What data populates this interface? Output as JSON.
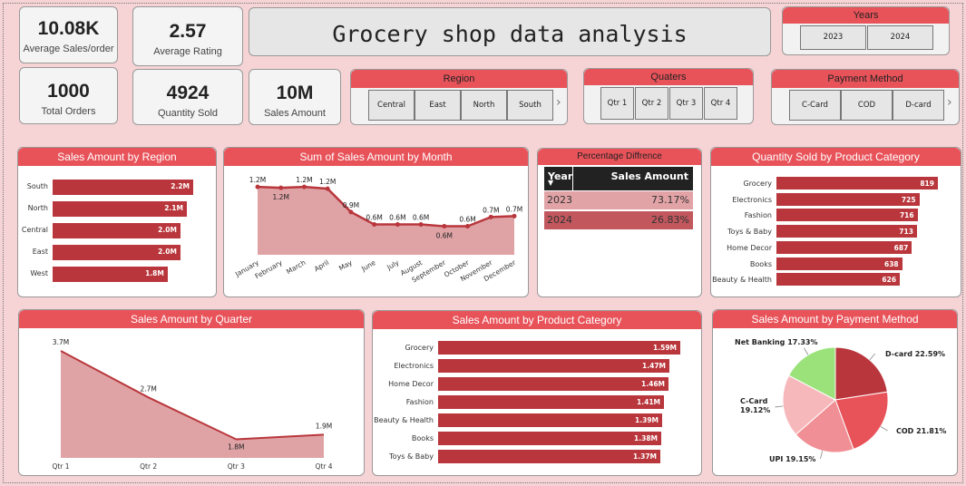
{
  "title": "Grocery shop data analysis",
  "kpis": [
    {
      "value": "10.08K",
      "label": "Average Sales/order"
    },
    {
      "value": "2.57",
      "label": "Average Rating"
    },
    {
      "value": "1000",
      "label": "Total Orders"
    },
    {
      "value": "4924",
      "label": "Quantity Sold"
    },
    {
      "value": "10M",
      "label": "Sales Amount"
    }
  ],
  "slicers": {
    "years": {
      "title": "Years",
      "options": [
        "2023",
        "2024"
      ]
    },
    "region": {
      "title": "Region",
      "options": [
        "Central",
        "East",
        "North",
        "South"
      ]
    },
    "quarters": {
      "title": "Quaters",
      "options": [
        "Qtr 1",
        "Qtr 2",
        "Qtr 3",
        "Qtr 4"
      ]
    },
    "payment": {
      "title": "Payment Method",
      "options": [
        "C-Card",
        "COD",
        "D-card"
      ]
    }
  },
  "region_chart": {
    "title": "Sales Amount by Region",
    "categories": [
      "South",
      "North",
      "Central",
      "East",
      "West"
    ],
    "values": [
      2.2,
      2.1,
      2.0,
      2.0,
      1.8
    ],
    "labels": [
      "2.2M",
      "2.1M",
      "2.0M",
      "2.0M",
      "1.8M"
    ]
  },
  "month_chart": {
    "title": "Sum of Sales Amount by Month",
    "months": [
      "January",
      "February",
      "March",
      "April",
      "May",
      "June",
      "July",
      "August",
      "September",
      "October",
      "November",
      "December"
    ],
    "values": [
      1.2,
      1.2,
      1.2,
      1.2,
      0.9,
      0.6,
      0.6,
      0.6,
      0.6,
      0.6,
      0.7,
      0.7
    ],
    "labels": [
      "1.2M",
      "1.2M",
      "1.2M",
      "1.2M",
      "0.9M",
      "0.6M",
      "0.6M",
      "0.6M",
      "0.6M",
      "0.6M",
      "0.7M",
      "0.7M"
    ]
  },
  "pct_table": {
    "title": "Percentage Diffrence",
    "headers": [
      "Year",
      "Sales Amount"
    ],
    "rows": [
      [
        "2023",
        "73.17%"
      ],
      [
        "2024",
        "26.83%"
      ]
    ]
  },
  "qty_chart": {
    "title": "Quantity Sold by Product Category",
    "categories": [
      "Grocery",
      "Electronics",
      "Fashion",
      "Toys & Baby",
      "Home Decor",
      "Books",
      "Beauty & Health"
    ],
    "values": [
      819,
      725,
      716,
      713,
      687,
      638,
      626
    ],
    "labels": [
      "819",
      "725",
      "716",
      "713",
      "687",
      "638",
      "626"
    ]
  },
  "quarter_chart": {
    "title": "Sales Amount by Quarter",
    "categories": [
      "Qtr 1",
      "Qtr 2",
      "Qtr 3",
      "Qtr 4"
    ],
    "values": [
      3.7,
      2.7,
      1.8,
      1.9
    ],
    "labels": [
      "3.7M",
      "2.7M",
      "1.8M",
      "1.9M"
    ]
  },
  "cat_chart": {
    "title": "Sales Amount by Product Category",
    "categories": [
      "Grocery",
      "Electronics",
      "Home Decor",
      "Fashion",
      "Beauty & Health",
      "Books",
      "Toys & Baby"
    ],
    "values": [
      1.59,
      1.47,
      1.46,
      1.41,
      1.39,
      1.38,
      1.37
    ],
    "labels": [
      "1.59M",
      "1.47M",
      "1.46M",
      "1.41M",
      "1.39M",
      "1.38M",
      "1.37M"
    ]
  },
  "pay_chart": {
    "title": "Sales Amount by Payment Method",
    "slices": [
      {
        "name": "D-card",
        "pct": 22.59,
        "label": "D-card 22.59%",
        "color": "#b9373c"
      },
      {
        "name": "COD",
        "pct": 21.81,
        "label": "COD 21.81%",
        "color": "#e8535a"
      },
      {
        "name": "UPI",
        "pct": 19.15,
        "label": "UPI 19.15%",
        "color": "#f08f95"
      },
      {
        "name": "C-Card",
        "pct": 19.12,
        "label": "C-Card 19.12%",
        "color": "#f7b8bc"
      },
      {
        "name": "Net Banking",
        "pct": 17.33,
        "label": "Net Banking 17.33%",
        "color": "#9be27b"
      }
    ]
  },
  "colors": {
    "accent": "#e8535a",
    "bar": "#b9373c",
    "area": "#dfa3a6",
    "background": "#f6d3d5"
  },
  "chart_data": [
    {
      "type": "bar",
      "title": "Sales Amount by Region",
      "categories": [
        "South",
        "North",
        "Central",
        "East",
        "West"
      ],
      "values": [
        2.2,
        2.1,
        2.0,
        2.0,
        1.8
      ]
    },
    {
      "type": "area",
      "title": "Sum of Sales Amount by Month",
      "categories": [
        "January",
        "February",
        "March",
        "April",
        "May",
        "June",
        "July",
        "August",
        "September",
        "October",
        "November",
        "December"
      ],
      "values": [
        1.2,
        1.2,
        1.2,
        1.2,
        0.9,
        0.6,
        0.6,
        0.6,
        0.6,
        0.6,
        0.7,
        0.7
      ]
    },
    {
      "type": "table",
      "title": "Percentage Diffrence",
      "headers": [
        "Year",
        "Sales Amount"
      ],
      "rows": [
        [
          "2023",
          "73.17%"
        ],
        [
          "2024",
          "26.83%"
        ]
      ]
    },
    {
      "type": "bar",
      "title": "Quantity Sold by Product Category",
      "categories": [
        "Grocery",
        "Electronics",
        "Fashion",
        "Toys & Baby",
        "Home Decor",
        "Books",
        "Beauty & Health"
      ],
      "values": [
        819,
        725,
        716,
        713,
        687,
        638,
        626
      ]
    },
    {
      "type": "area",
      "title": "Sales Amount by Quarter",
      "categories": [
        "Qtr 1",
        "Qtr 2",
        "Qtr 3",
        "Qtr 4"
      ],
      "values": [
        3.7,
        2.7,
        1.8,
        1.9
      ]
    },
    {
      "type": "bar",
      "title": "Sales Amount by Product Category",
      "categories": [
        "Grocery",
        "Electronics",
        "Home Decor",
        "Fashion",
        "Beauty & Health",
        "Books",
        "Toys & Baby"
      ],
      "values": [
        1.59,
        1.47,
        1.46,
        1.41,
        1.39,
        1.38,
        1.37
      ]
    },
    {
      "type": "pie",
      "title": "Sales Amount by Payment Method",
      "categories": [
        "D-card",
        "COD",
        "UPI",
        "C-Card",
        "Net Banking"
      ],
      "values": [
        22.59,
        21.81,
        19.15,
        19.12,
        17.33
      ]
    }
  ]
}
